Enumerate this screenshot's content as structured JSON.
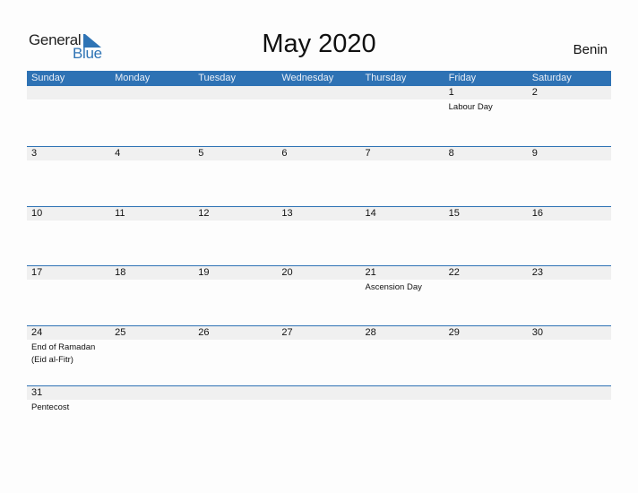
{
  "logo": {
    "general": "General",
    "blue": "Blue"
  },
  "title": "May 2020",
  "country": "Benin",
  "colors": {
    "accent": "#2e72b4",
    "day_bar": "#f0f0f0"
  },
  "weekdays": [
    "Sunday",
    "Monday",
    "Tuesday",
    "Wednesday",
    "Thursday",
    "Friday",
    "Saturday"
  ],
  "weeks": [
    [
      {
        "day": "",
        "event": ""
      },
      {
        "day": "",
        "event": ""
      },
      {
        "day": "",
        "event": ""
      },
      {
        "day": "",
        "event": ""
      },
      {
        "day": "",
        "event": ""
      },
      {
        "day": "1",
        "event": "Labour Day"
      },
      {
        "day": "2",
        "event": ""
      }
    ],
    [
      {
        "day": "3",
        "event": ""
      },
      {
        "day": "4",
        "event": ""
      },
      {
        "day": "5",
        "event": ""
      },
      {
        "day": "6",
        "event": ""
      },
      {
        "day": "7",
        "event": ""
      },
      {
        "day": "8",
        "event": ""
      },
      {
        "day": "9",
        "event": ""
      }
    ],
    [
      {
        "day": "10",
        "event": ""
      },
      {
        "day": "11",
        "event": ""
      },
      {
        "day": "12",
        "event": ""
      },
      {
        "day": "13",
        "event": ""
      },
      {
        "day": "14",
        "event": ""
      },
      {
        "day": "15",
        "event": ""
      },
      {
        "day": "16",
        "event": ""
      }
    ],
    [
      {
        "day": "17",
        "event": ""
      },
      {
        "day": "18",
        "event": ""
      },
      {
        "day": "19",
        "event": ""
      },
      {
        "day": "20",
        "event": ""
      },
      {
        "day": "21",
        "event": "Ascension Day"
      },
      {
        "day": "22",
        "event": ""
      },
      {
        "day": "23",
        "event": ""
      }
    ],
    [
      {
        "day": "24",
        "event": "End of Ramadan (Eid al-Fitr)"
      },
      {
        "day": "25",
        "event": ""
      },
      {
        "day": "26",
        "event": ""
      },
      {
        "day": "27",
        "event": ""
      },
      {
        "day": "28",
        "event": ""
      },
      {
        "day": "29",
        "event": ""
      },
      {
        "day": "30",
        "event": ""
      }
    ],
    [
      {
        "day": "31",
        "event": "Pentecost"
      },
      {
        "day": "",
        "event": ""
      },
      {
        "day": "",
        "event": ""
      },
      {
        "day": "",
        "event": ""
      },
      {
        "day": "",
        "event": ""
      },
      {
        "day": "",
        "event": ""
      },
      {
        "day": "",
        "event": ""
      }
    ]
  ]
}
